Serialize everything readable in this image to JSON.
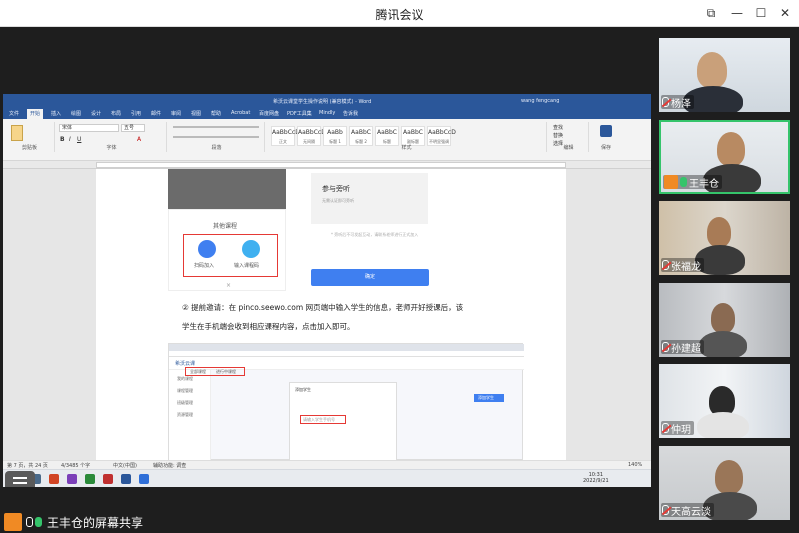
{
  "app": {
    "title": "腾讯会议",
    "window_controls": {
      "minimize": "—",
      "maximize": "☐",
      "close": "✕",
      "restore": "⧉"
    }
  },
  "word": {
    "doc_title": "希沃云课堂学生操作说明 (兼容模式) - Word",
    "user": "wang fengcang",
    "tabs": [
      "文件",
      "开始",
      "插入",
      "绘图",
      "设计",
      "布局",
      "引用",
      "邮件",
      "审阅",
      "视图",
      "帮助",
      "Acrobat",
      "百度网盘",
      "PDF工具集",
      "Mindly",
      "告诉我"
    ],
    "active_tab": "开始",
    "font_name": "宋体",
    "font_size": "五号",
    "groups": {
      "clipboard": "剪贴板",
      "font": "字体",
      "paragraph": "段落",
      "styles": "样式",
      "editing": "编辑",
      "save": "保存"
    },
    "styles": [
      {
        "preview": "AaBbCcDd",
        "name": "正文"
      },
      {
        "preview": "AaBbCcDd",
        "name": "无间隔"
      },
      {
        "preview": "AaBb",
        "name": "标题 1"
      },
      {
        "preview": "AaBbC",
        "name": "标题 2"
      },
      {
        "preview": "AaBbC",
        "name": "标题"
      },
      {
        "preview": "AaBbC",
        "name": "副标题"
      },
      {
        "preview": "AaBbCcD",
        "name": "不明显强调"
      }
    ],
    "editing_items": [
      "查找",
      "替换",
      "选择"
    ],
    "phone": {
      "other_label": "其他课程",
      "option_1": "扫码加入",
      "option_2": "输入课程码",
      "close": "×",
      "card_title": "参与旁听",
      "card_sub": "无需认证即可旁听",
      "hint": "* 旁听后不可发起互动，请联系老师进行正式加入",
      "confirm": "确定"
    },
    "paragraph_1": "② 提前邀请：在 pinco.seewo.com 网页端中输入学生的信息，老师开好授课后，该",
    "paragraph_2": "学生在手机端会收到相应课程内容，点击加入即可。",
    "browser": {
      "brand": "希沃云课",
      "side_items": [
        "我的课程",
        "课程管理",
        "班级管理",
        "资源管理"
      ],
      "tabs": [
        "全部课程",
        "进行中课程"
      ],
      "modal_title": "添加学生",
      "modal_field": "请输入学生手机号",
      "action": "添加学生"
    },
    "status": {
      "page": "第 7 页，共 24 页",
      "words": "4/3485 个字",
      "lang": "中文(中国)",
      "accessibility": "辅助功能: 调查",
      "zoom": "140%"
    },
    "taskbar_time": "10:31",
    "taskbar_date": "2022/9/21"
  },
  "sharer": {
    "label": "王丰仓的屏幕共享"
  },
  "participants": [
    {
      "name": "杨泽",
      "mic": "off",
      "active": false
    },
    {
      "name": "王丰仓",
      "mic": "on",
      "active": true
    },
    {
      "name": "张福龙",
      "mic": "off",
      "active": false
    },
    {
      "name": "孙建超",
      "mic": "off",
      "active": false
    },
    {
      "name": "仲玥",
      "mic": "off",
      "active": false
    },
    {
      "name": "天高云淡",
      "mic": "off",
      "active": false
    }
  ],
  "colors": {
    "word_blue": "#2b579a",
    "accent_green": "#35c46b",
    "accent_orange": "#f08a24",
    "red_highlight": "#e53935",
    "link_blue": "#3f7ff0"
  }
}
